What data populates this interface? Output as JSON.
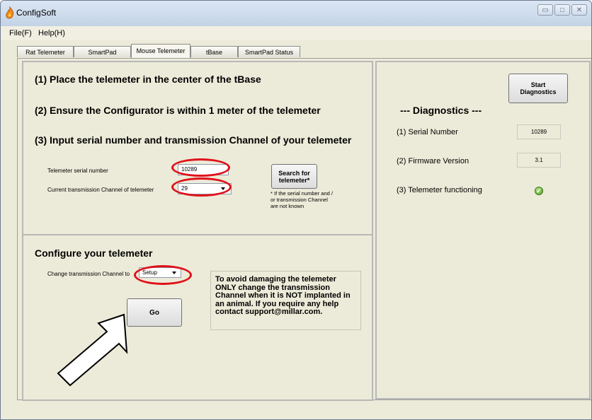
{
  "window": {
    "title": "ConfigSoft"
  },
  "menu": [
    "File(F)",
    "Help(H)"
  ],
  "tabs": [
    "Rat Telemeter",
    "SmartPad",
    "Mouse Telemeter",
    "tBase",
    "SmartPad Status"
  ],
  "active_tab": "Mouse Telemeter",
  "instructions": {
    "step1": "(1) Place the telemeter in the center of the tBase",
    "step2": "(2) Ensure the Configurator is within 1 meter of the telemeter",
    "step3": "(3) Input serial number and transmission Channel of your telemeter"
  },
  "fields": {
    "serial_label": "Telemeter serial number",
    "serial_value": "10289",
    "channel_label": "Current transmission Channel of telemeter",
    "channel_value": "29"
  },
  "search": {
    "button_line1": "Search for",
    "button_line2": "telemeter*",
    "note": "* If the serial number and /\nor transmission Channel\nare not known"
  },
  "configure": {
    "heading": "Configure your telemeter",
    "change_label": "Change transmission Channel to",
    "change_value": "Setup",
    "go_label": "Go",
    "warning": "To avoid damaging the telemeter ONLY change the transmission Channel when it is NOT implanted in an animal.  If you require any help contact support@millar.com."
  },
  "diagnostics": {
    "title": "--- Diagnostics ---",
    "start_line1": "Start",
    "start_line2": "Diagnostics",
    "serial_label": "(1) Serial Number",
    "serial_value": "10289",
    "firmware_label": "(2) Firmware Version",
    "firmware_value": "3.1",
    "functioning_label": "(3) Telemeter functioning",
    "functioning_icon": "check-icon"
  },
  "colors": {
    "highlight": "#e0101a",
    "background": "#ecebd9"
  }
}
